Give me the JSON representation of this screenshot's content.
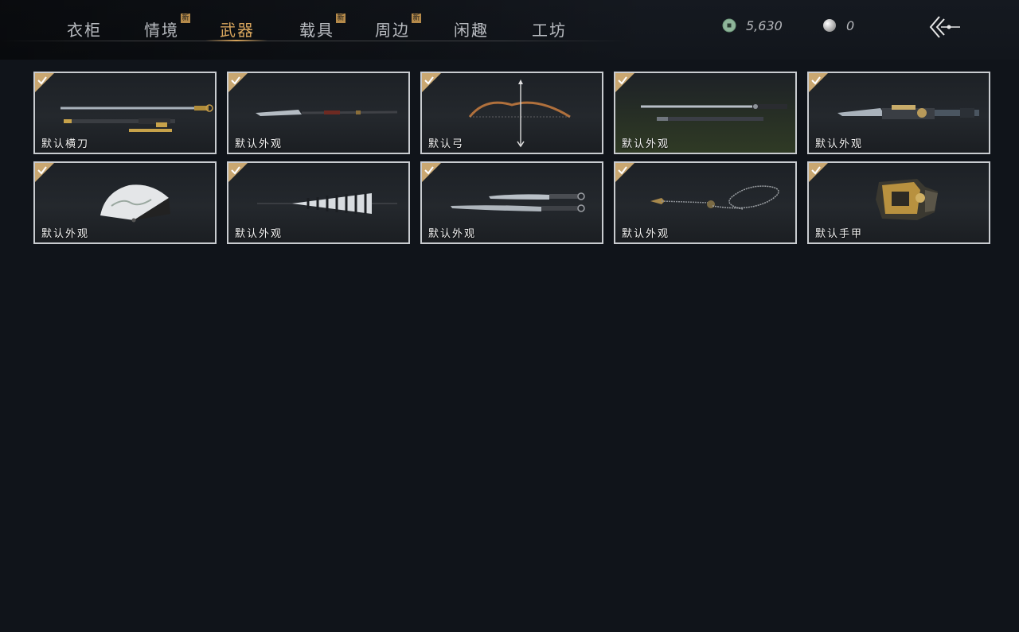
{
  "tabs": [
    {
      "label": "衣柜",
      "active": false,
      "new": false
    },
    {
      "label": "情境",
      "active": false,
      "new": true
    },
    {
      "label": "武器",
      "active": true,
      "new": false
    },
    {
      "label": "载具",
      "active": false,
      "new": true
    },
    {
      "label": "周边",
      "active": false,
      "new": true
    },
    {
      "label": "闲趣",
      "active": false,
      "new": false
    },
    {
      "label": "工坊",
      "active": false,
      "new": false
    }
  ],
  "new_badge": "新",
  "currencies": [
    {
      "icon": "jade-coin-icon",
      "value": "5,630",
      "color": "#8fb59a"
    },
    {
      "icon": "pearl-icon",
      "value": "0",
      "color": "#e8e8e8"
    }
  ],
  "back_icon": "back-arrow-icon",
  "accent_color": "#d7a45c",
  "items": [
    {
      "label": "默认横刀",
      "equipped": true,
      "art": "sword-icon"
    },
    {
      "label": "默认外观",
      "equipped": true,
      "art": "spear-icon"
    },
    {
      "label": "默认弓",
      "equipped": true,
      "art": "bow-icon"
    },
    {
      "label": "默认外观",
      "equipped": true,
      "art": "twin-sword-icon"
    },
    {
      "label": "默认外观",
      "equipped": true,
      "art": "mech-blade-icon"
    },
    {
      "label": "默认外观",
      "equipped": true,
      "art": "fan-icon"
    },
    {
      "label": "默认外观",
      "equipped": true,
      "art": "umbrella-icon"
    },
    {
      "label": "默认外观",
      "equipped": true,
      "art": "dual-blades-icon"
    },
    {
      "label": "默认外观",
      "equipped": true,
      "art": "rope-dart-icon"
    },
    {
      "label": "默认手甲",
      "equipped": true,
      "art": "gauntlet-icon"
    }
  ]
}
